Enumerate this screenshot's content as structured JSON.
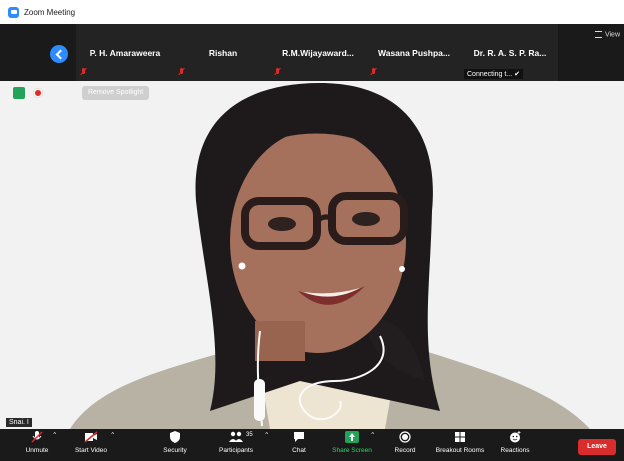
{
  "window": {
    "title": "Zoom Meeting"
  },
  "filmstrip": {
    "participants": [
      {
        "name": "P. H. Amaraweera",
        "muted": true
      },
      {
        "name": "Rishan",
        "muted": true
      },
      {
        "name": "R.M.Wijayaward...",
        "muted": true
      },
      {
        "name": "Wasana  Pushpa...",
        "muted": true
      },
      {
        "name": "Dr. R. A. S. P. Ra...",
        "status": "Connecting t...  ✔"
      }
    ],
    "view_label": "View"
  },
  "video": {
    "remove_spotlight_label": "Remove Spotlight",
    "name_tag": "Snai. I"
  },
  "toolbar": {
    "unmute": "Unmute",
    "start_video": "Start Video",
    "security": "Security",
    "participants": "Participants",
    "participant_count": "35",
    "chat": "Chat",
    "share_screen": "Share Screen",
    "record": "Record",
    "breakout_rooms": "Breakout Rooms",
    "reactions": "Reactions",
    "leave": "Leave"
  },
  "colors": {
    "accent": "#2d8cff",
    "leave": "#d92d2d",
    "share": "#23a35a",
    "mute": "#e02828"
  }
}
